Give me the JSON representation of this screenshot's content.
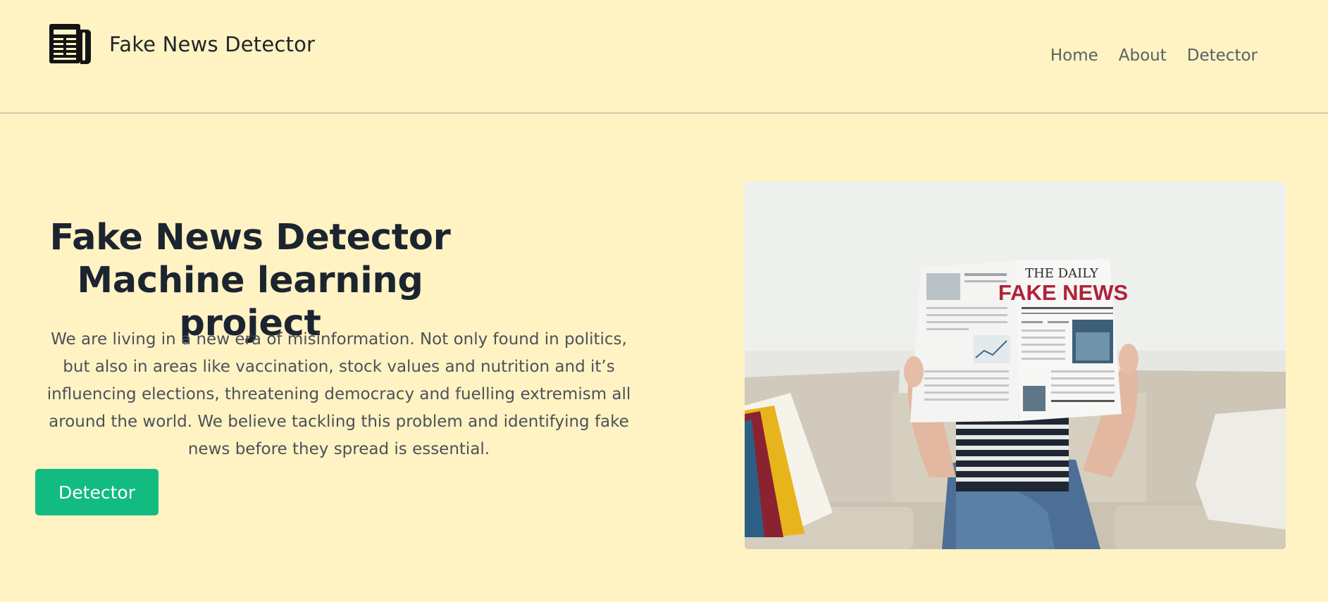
{
  "header": {
    "brand_name": "Fake News Detector",
    "logo_icon": "newspaper-icon"
  },
  "nav": {
    "items": [
      {
        "label": "Home"
      },
      {
        "label": "About"
      },
      {
        "label": "Detector"
      }
    ]
  },
  "hero": {
    "title_line1": "Fake News Detector",
    "title_line2": "Machine learning project",
    "description": "We are living in a new era of misinformation. Not only found in politics, but also in areas like vaccination, stock values and nutrition and it’s influencing elections, threatening democracy and fuelling extremism all around the world. We believe tackling this problem and identifying fake news before they spread is essential.",
    "cta_label": "Detector",
    "image": {
      "newspaper_masthead": "THE DAILY",
      "newspaper_headline": "FAKE NEWS"
    }
  },
  "colors": {
    "background": "#fff3c4",
    "accent": "#12bb80",
    "headline_red": "#b0223a"
  }
}
